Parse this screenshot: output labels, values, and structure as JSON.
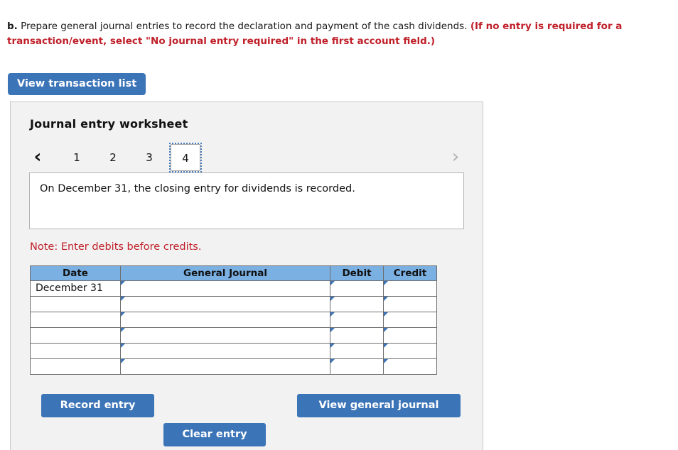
{
  "instruction": {
    "prefix": "b.",
    "main": " Prepare general journal entries to record the declaration and payment of the cash dividends. ",
    "emphasis": "(If no entry is required for a transaction/event, select \"No journal entry required\" in the first account field.)"
  },
  "toolbar": {
    "view_transaction_list_label": "View transaction list"
  },
  "worksheet": {
    "title": "Journal entry worksheet",
    "nav": {
      "prev_icon": "‹",
      "next_icon": "›"
    },
    "tabs": [
      {
        "label": "1",
        "selected": false
      },
      {
        "label": "2",
        "selected": false
      },
      {
        "label": "3",
        "selected": false
      },
      {
        "label": "4",
        "selected": true
      }
    ],
    "description": "On December 31, the closing entry for dividends is recorded.",
    "note": "Note: Enter debits before credits.",
    "table": {
      "columns": [
        "Date",
        "General Journal",
        "Debit",
        "Credit"
      ],
      "rows": [
        {
          "date": "December 31",
          "general_journal": "",
          "debit": "",
          "credit": ""
        },
        {
          "date": "",
          "general_journal": "",
          "debit": "",
          "credit": ""
        },
        {
          "date": "",
          "general_journal": "",
          "debit": "",
          "credit": ""
        },
        {
          "date": "",
          "general_journal": "",
          "debit": "",
          "credit": ""
        },
        {
          "date": "",
          "general_journal": "",
          "debit": "",
          "credit": ""
        },
        {
          "date": "",
          "general_journal": "",
          "debit": "",
          "credit": ""
        }
      ]
    },
    "actions": {
      "record_entry_label": "Record entry",
      "clear_entry_label": "Clear entry",
      "view_general_journal_label": "View general journal"
    }
  },
  "colors": {
    "button_blue": "#3c74b8",
    "table_header_blue": "#7bb0e3",
    "alert_red": "#c0202a",
    "panel_background": "#f2f2f2"
  }
}
